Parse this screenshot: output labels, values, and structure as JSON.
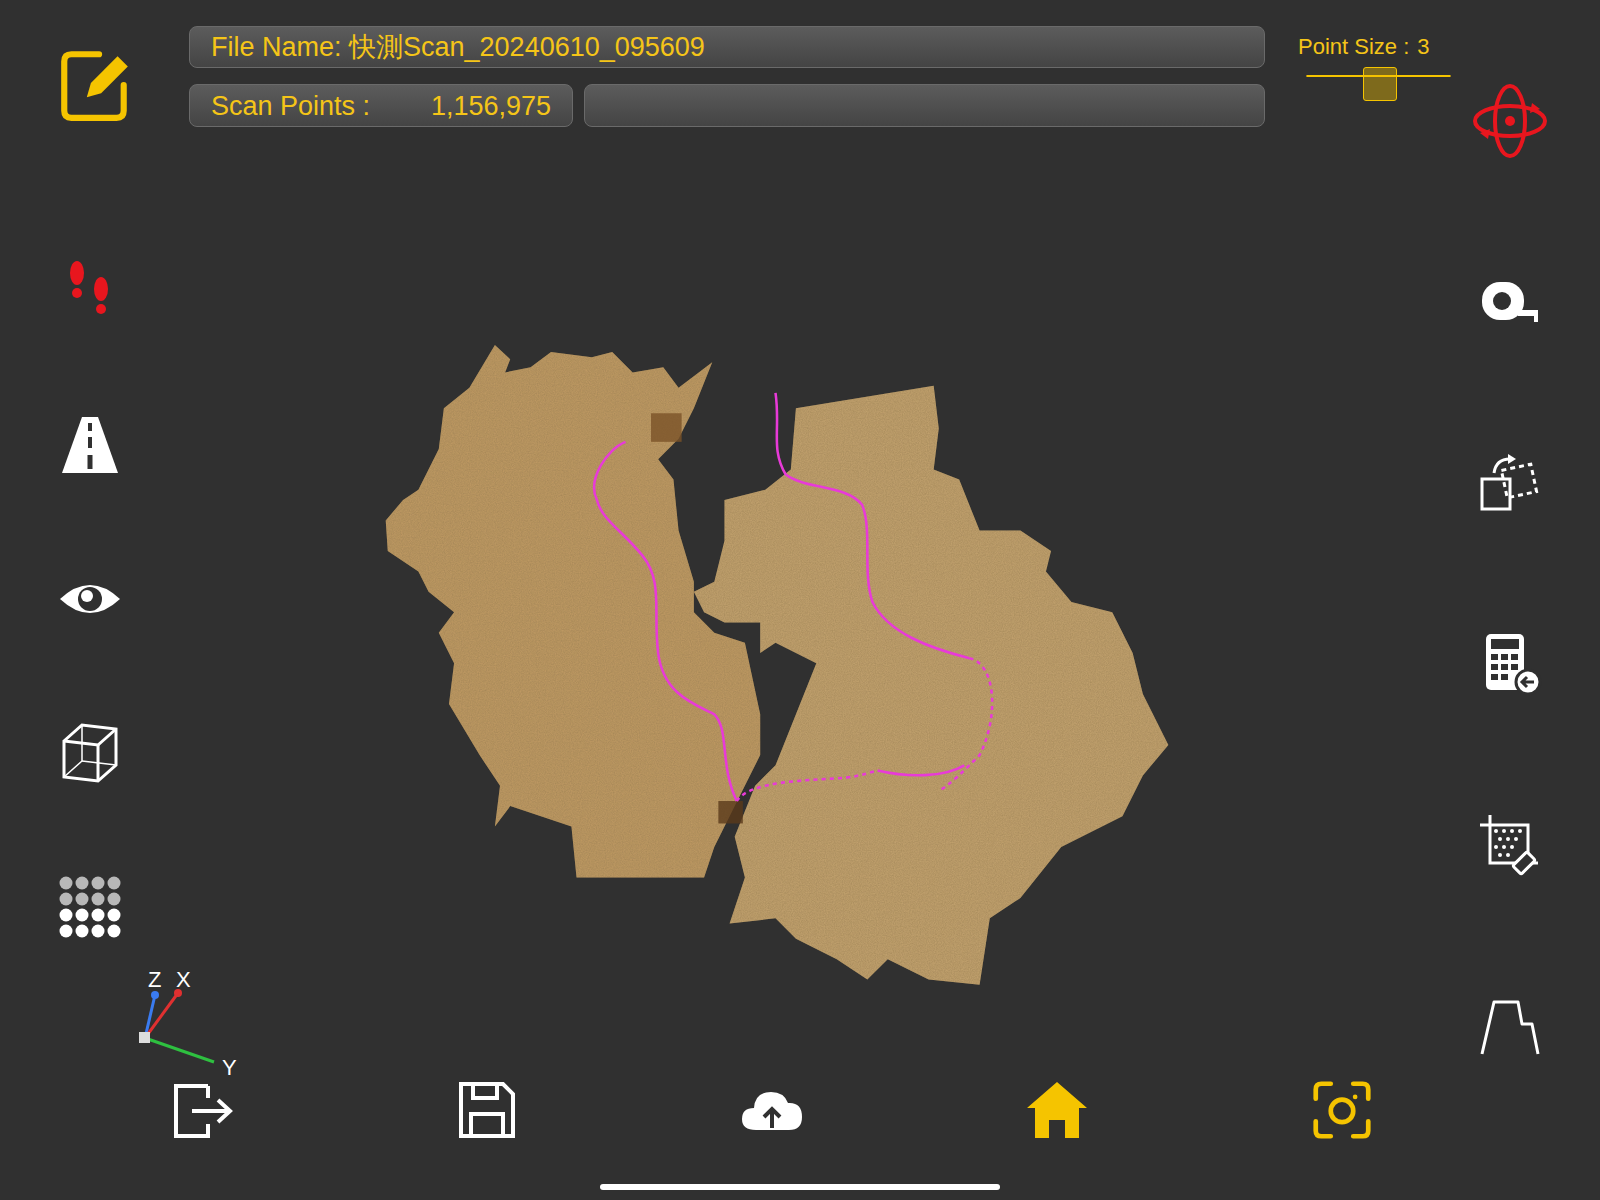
{
  "header": {
    "file_name": "File Name: 快測Scan_20240610_095609",
    "scan_points_label": "Scan Points :",
    "scan_points_value": "1,156,975"
  },
  "point_size": {
    "label": "Point Size :",
    "value": "3",
    "level": 0.5
  },
  "left_tools": [
    {
      "kind": "walk",
      "active": true
    },
    {
      "kind": "road",
      "active": false
    },
    {
      "kind": "view",
      "active": false
    },
    {
      "kind": "box",
      "active": false
    },
    {
      "kind": "points",
      "active": false
    }
  ],
  "right_tools": [
    {
      "kind": "rotate",
      "active": true
    },
    {
      "kind": "measure",
      "active": false
    },
    {
      "kind": "transform",
      "active": false
    },
    {
      "kind": "calculator",
      "active": false
    },
    {
      "kind": "crop",
      "active": false
    },
    {
      "kind": "profile",
      "active": false
    }
  ],
  "bottom_bar": [
    {
      "kind": "exit",
      "active": false
    },
    {
      "kind": "save",
      "active": false
    },
    {
      "kind": "upload",
      "active": false
    },
    {
      "kind": "home",
      "active": true
    },
    {
      "kind": "scan",
      "active": true
    }
  ],
  "axes": {
    "z": "Z",
    "x": "X",
    "y": "Y"
  }
}
